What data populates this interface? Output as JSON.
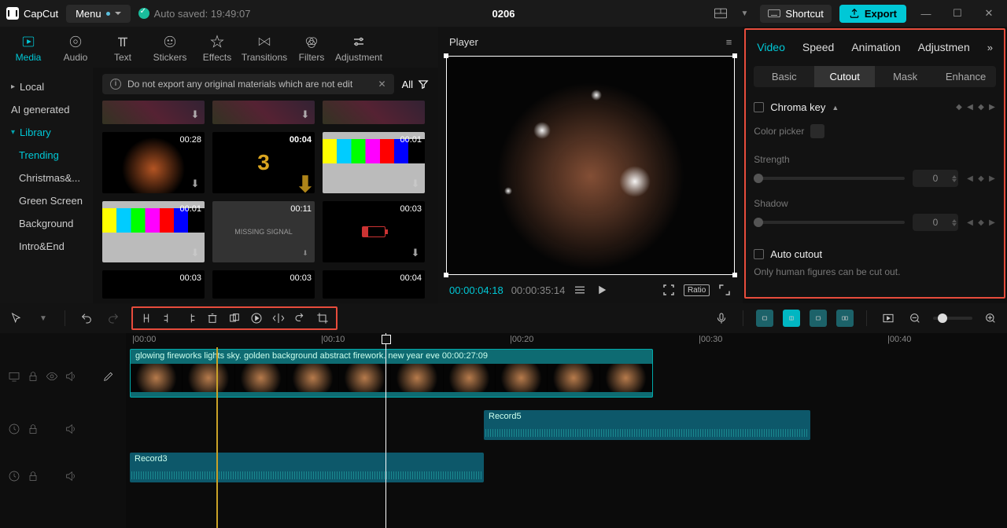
{
  "titlebar": {
    "brand": "CapCut",
    "menu": "Menu",
    "save_status": "Auto saved: 19:49:07",
    "project": "0206",
    "shortcut": "Shortcut",
    "export": "Export"
  },
  "asset_tabs": [
    "Media",
    "Audio",
    "Text",
    "Stickers",
    "Effects",
    "Transitions",
    "Filters",
    "Adjustment"
  ],
  "sidenav": {
    "local": "Local",
    "ai": "AI generated",
    "library": "Library",
    "lib_children": [
      "Trending",
      "Christmas&...",
      "Green Screen",
      "Background",
      "Intro&End"
    ]
  },
  "warn": "Do not export any original materials which are not edit",
  "all": "All",
  "thumbs": {
    "t1": "00:28",
    "t2": "00:04",
    "t3": "00:01",
    "t4": "00:01",
    "t5": "00:11",
    "t6": "00:03",
    "t7": "00:03",
    "t8": "00:03",
    "t9": "00:04",
    "missing": "MISSING SIGNAL",
    "count": "3"
  },
  "player": {
    "title": "Player",
    "cur": "00:00:04:18",
    "dur": "00:00:35:14",
    "ratio": "Ratio"
  },
  "inspector": {
    "tabs": [
      "Video",
      "Speed",
      "Animation",
      "Adjustmen"
    ],
    "subtabs": [
      "Basic",
      "Cutout",
      "Mask",
      "Enhance"
    ],
    "chroma": "Chroma key",
    "picker": "Color picker",
    "strength": "Strength",
    "strength_v": "0",
    "shadow": "Shadow",
    "shadow_v": "0",
    "auto": "Auto cutout",
    "auto_desc": "Only human figures can be cut out."
  },
  "timeline": {
    "cliplabel": "glowing fireworks lights sky. golden background abstract firework. new year eve   00:00:27:09",
    "record5": "Record5",
    "record3": "Record3",
    "marks": [
      "|00:00",
      "|00:10",
      "|00:20",
      "|00:30",
      "|00:40"
    ]
  }
}
